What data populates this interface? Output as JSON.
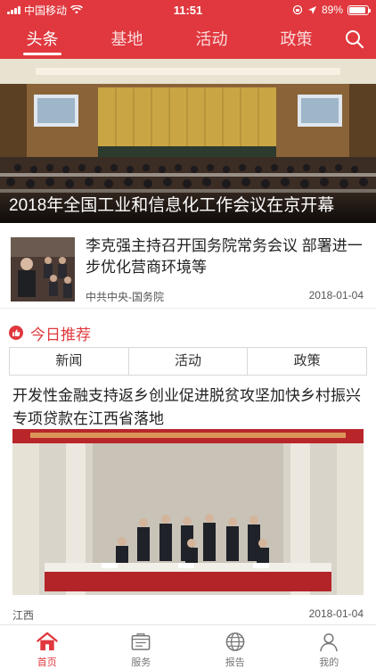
{
  "status_bar": {
    "carrier": "中国移动",
    "time": "11:51",
    "battery": "89%",
    "battery_level": 0.89
  },
  "top_nav": {
    "tabs": [
      {
        "label": "头条",
        "active": true
      },
      {
        "label": "基地",
        "active": false
      },
      {
        "label": "活动",
        "active": false
      },
      {
        "label": "政策",
        "active": false
      }
    ],
    "search_icon": "search-icon"
  },
  "hero": {
    "caption": "2018年全国工业和信息化工作会议在京开幕"
  },
  "news_item": {
    "title": "李克强主持召开国务院常务会议 部署进一步优化营商环境等",
    "source": "中共中央-国务院",
    "date": "2018-01-04"
  },
  "recommend": {
    "title": "今日推荐",
    "icon": "thumbs-up-icon",
    "segments": [
      "新闻",
      "活动",
      "政策"
    ]
  },
  "article": {
    "title": "开发性金融支持返乡创业促进脱贫攻坚加快乡村振兴专项贷款在江西省落地",
    "source": "江西",
    "date": "2018-01-04"
  },
  "bottom_bar": {
    "items": [
      {
        "label": "首页",
        "icon": "home-icon",
        "active": true
      },
      {
        "label": "服务",
        "icon": "service-icon",
        "active": false
      },
      {
        "label": "报告",
        "icon": "globe-icon",
        "active": false
      },
      {
        "label": "我的",
        "icon": "user-icon",
        "active": false
      }
    ]
  },
  "colors": {
    "brand_red": "#e0383e",
    "inactive_gray": "#777777"
  }
}
